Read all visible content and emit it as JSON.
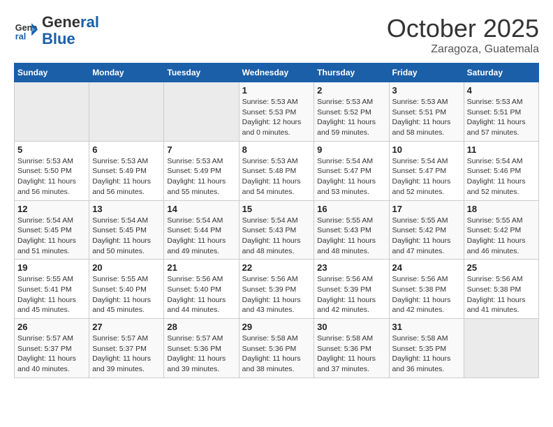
{
  "logo": {
    "line1": "General",
    "line2": "Blue"
  },
  "title": "October 2025",
  "subtitle": "Zaragoza, Guatemala",
  "days_of_week": [
    "Sunday",
    "Monday",
    "Tuesday",
    "Wednesday",
    "Thursday",
    "Friday",
    "Saturday"
  ],
  "weeks": [
    [
      {
        "day": "",
        "sunrise": "",
        "sunset": "",
        "daylight": ""
      },
      {
        "day": "",
        "sunrise": "",
        "sunset": "",
        "daylight": ""
      },
      {
        "day": "",
        "sunrise": "",
        "sunset": "",
        "daylight": ""
      },
      {
        "day": "1",
        "sunrise": "Sunrise: 5:53 AM",
        "sunset": "Sunset: 5:53 PM",
        "daylight": "Daylight: 12 hours and 0 minutes."
      },
      {
        "day": "2",
        "sunrise": "Sunrise: 5:53 AM",
        "sunset": "Sunset: 5:52 PM",
        "daylight": "Daylight: 11 hours and 59 minutes."
      },
      {
        "day": "3",
        "sunrise": "Sunrise: 5:53 AM",
        "sunset": "Sunset: 5:51 PM",
        "daylight": "Daylight: 11 hours and 58 minutes."
      },
      {
        "day": "4",
        "sunrise": "Sunrise: 5:53 AM",
        "sunset": "Sunset: 5:51 PM",
        "daylight": "Daylight: 11 hours and 57 minutes."
      }
    ],
    [
      {
        "day": "5",
        "sunrise": "Sunrise: 5:53 AM",
        "sunset": "Sunset: 5:50 PM",
        "daylight": "Daylight: 11 hours and 56 minutes."
      },
      {
        "day": "6",
        "sunrise": "Sunrise: 5:53 AM",
        "sunset": "Sunset: 5:49 PM",
        "daylight": "Daylight: 11 hours and 56 minutes."
      },
      {
        "day": "7",
        "sunrise": "Sunrise: 5:53 AM",
        "sunset": "Sunset: 5:49 PM",
        "daylight": "Daylight: 11 hours and 55 minutes."
      },
      {
        "day": "8",
        "sunrise": "Sunrise: 5:53 AM",
        "sunset": "Sunset: 5:48 PM",
        "daylight": "Daylight: 11 hours and 54 minutes."
      },
      {
        "day": "9",
        "sunrise": "Sunrise: 5:54 AM",
        "sunset": "Sunset: 5:47 PM",
        "daylight": "Daylight: 11 hours and 53 minutes."
      },
      {
        "day": "10",
        "sunrise": "Sunrise: 5:54 AM",
        "sunset": "Sunset: 5:47 PM",
        "daylight": "Daylight: 11 hours and 52 minutes."
      },
      {
        "day": "11",
        "sunrise": "Sunrise: 5:54 AM",
        "sunset": "Sunset: 5:46 PM",
        "daylight": "Daylight: 11 hours and 52 minutes."
      }
    ],
    [
      {
        "day": "12",
        "sunrise": "Sunrise: 5:54 AM",
        "sunset": "Sunset: 5:45 PM",
        "daylight": "Daylight: 11 hours and 51 minutes."
      },
      {
        "day": "13",
        "sunrise": "Sunrise: 5:54 AM",
        "sunset": "Sunset: 5:45 PM",
        "daylight": "Daylight: 11 hours and 50 minutes."
      },
      {
        "day": "14",
        "sunrise": "Sunrise: 5:54 AM",
        "sunset": "Sunset: 5:44 PM",
        "daylight": "Daylight: 11 hours and 49 minutes."
      },
      {
        "day": "15",
        "sunrise": "Sunrise: 5:54 AM",
        "sunset": "Sunset: 5:43 PM",
        "daylight": "Daylight: 11 hours and 48 minutes."
      },
      {
        "day": "16",
        "sunrise": "Sunrise: 5:55 AM",
        "sunset": "Sunset: 5:43 PM",
        "daylight": "Daylight: 11 hours and 48 minutes."
      },
      {
        "day": "17",
        "sunrise": "Sunrise: 5:55 AM",
        "sunset": "Sunset: 5:42 PM",
        "daylight": "Daylight: 11 hours and 47 minutes."
      },
      {
        "day": "18",
        "sunrise": "Sunrise: 5:55 AM",
        "sunset": "Sunset: 5:42 PM",
        "daylight": "Daylight: 11 hours and 46 minutes."
      }
    ],
    [
      {
        "day": "19",
        "sunrise": "Sunrise: 5:55 AM",
        "sunset": "Sunset: 5:41 PM",
        "daylight": "Daylight: 11 hours and 45 minutes."
      },
      {
        "day": "20",
        "sunrise": "Sunrise: 5:55 AM",
        "sunset": "Sunset: 5:40 PM",
        "daylight": "Daylight: 11 hours and 45 minutes."
      },
      {
        "day": "21",
        "sunrise": "Sunrise: 5:56 AM",
        "sunset": "Sunset: 5:40 PM",
        "daylight": "Daylight: 11 hours and 44 minutes."
      },
      {
        "day": "22",
        "sunrise": "Sunrise: 5:56 AM",
        "sunset": "Sunset: 5:39 PM",
        "daylight": "Daylight: 11 hours and 43 minutes."
      },
      {
        "day": "23",
        "sunrise": "Sunrise: 5:56 AM",
        "sunset": "Sunset: 5:39 PM",
        "daylight": "Daylight: 11 hours and 42 minutes."
      },
      {
        "day": "24",
        "sunrise": "Sunrise: 5:56 AM",
        "sunset": "Sunset: 5:38 PM",
        "daylight": "Daylight: 11 hours and 42 minutes."
      },
      {
        "day": "25",
        "sunrise": "Sunrise: 5:56 AM",
        "sunset": "Sunset: 5:38 PM",
        "daylight": "Daylight: 11 hours and 41 minutes."
      }
    ],
    [
      {
        "day": "26",
        "sunrise": "Sunrise: 5:57 AM",
        "sunset": "Sunset: 5:37 PM",
        "daylight": "Daylight: 11 hours and 40 minutes."
      },
      {
        "day": "27",
        "sunrise": "Sunrise: 5:57 AM",
        "sunset": "Sunset: 5:37 PM",
        "daylight": "Daylight: 11 hours and 39 minutes."
      },
      {
        "day": "28",
        "sunrise": "Sunrise: 5:57 AM",
        "sunset": "Sunset: 5:36 PM",
        "daylight": "Daylight: 11 hours and 39 minutes."
      },
      {
        "day": "29",
        "sunrise": "Sunrise: 5:58 AM",
        "sunset": "Sunset: 5:36 PM",
        "daylight": "Daylight: 11 hours and 38 minutes."
      },
      {
        "day": "30",
        "sunrise": "Sunrise: 5:58 AM",
        "sunset": "Sunset: 5:36 PM",
        "daylight": "Daylight: 11 hours and 37 minutes."
      },
      {
        "day": "31",
        "sunrise": "Sunrise: 5:58 AM",
        "sunset": "Sunset: 5:35 PM",
        "daylight": "Daylight: 11 hours and 36 minutes."
      },
      {
        "day": "",
        "sunrise": "",
        "sunset": "",
        "daylight": ""
      }
    ]
  ]
}
